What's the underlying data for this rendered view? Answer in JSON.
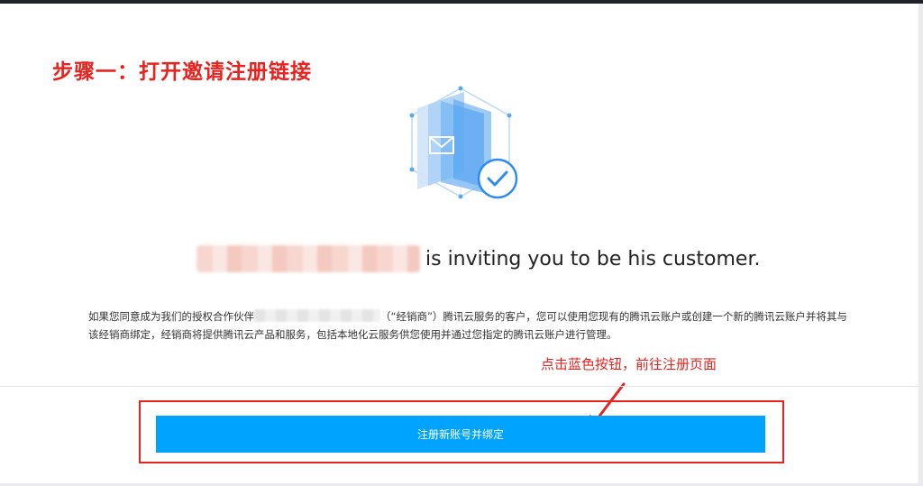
{
  "annotation": {
    "step_title": "步骤一：打开邀请注册链接",
    "hint": "点击蓝色按钮，前往注册页面"
  },
  "invite": {
    "text": "is inviting you to be his customer."
  },
  "description": {
    "part1": "如果您同意成为我们的授权合作伙伴",
    "part2": "（“经销商”）腾讯云服务的客户，您可以使用您现有的腾讯云账户或创建一个新的腾讯云账户并将其与该经销商绑定，经销商将提供腾讯云产品和服务，包括本地化云服务供您使用并通过您指定的腾讯云账户进行管理。"
  },
  "buttons": {
    "register_bind": "注册新账号并绑定"
  },
  "icons": {
    "hero": "envelope-verified-cube-icon",
    "arrow": "annotation-arrow-icon"
  },
  "colors": {
    "annotation_red": "#e8231f",
    "primary_blue": "#00a4ff"
  }
}
